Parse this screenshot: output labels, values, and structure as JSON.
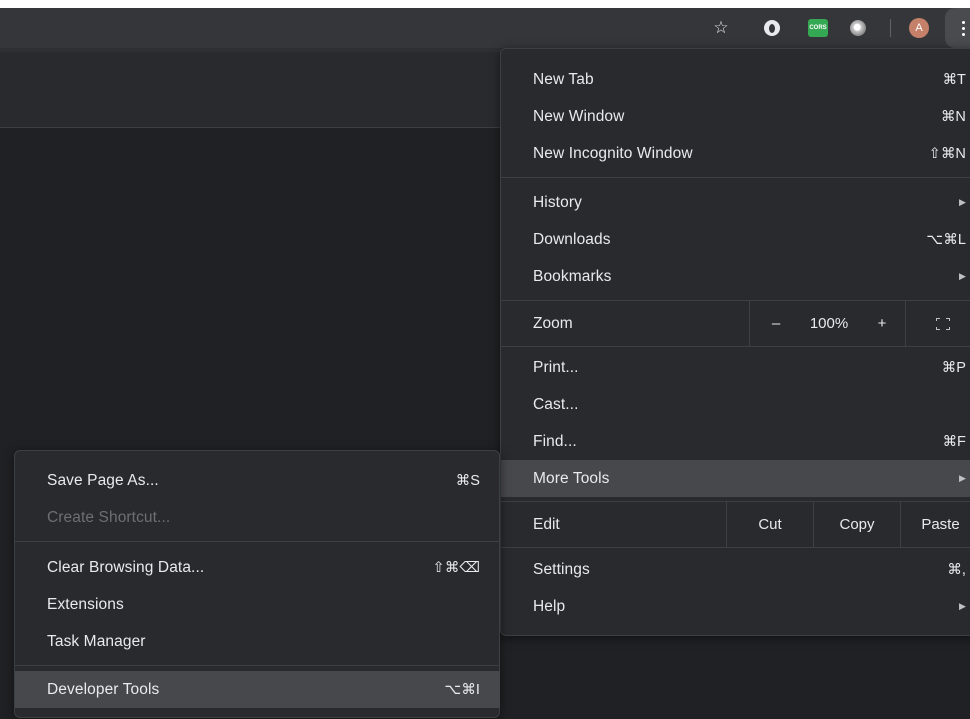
{
  "toolbar": {
    "star": "☆",
    "extension_cors": "CORS",
    "avatar_letter": "A"
  },
  "menu": {
    "new_tab": {
      "label": "New Tab",
      "shortcut": "⌘T"
    },
    "new_window": {
      "label": "New Window",
      "shortcut": "⌘N"
    },
    "new_incognito": {
      "label": "New Incognito Window",
      "shortcut": "⇧⌘N"
    },
    "history": {
      "label": "History",
      "arrow": "▶"
    },
    "downloads": {
      "label": "Downloads",
      "shortcut": "⌥⌘L"
    },
    "bookmarks": {
      "label": "Bookmarks",
      "arrow": "▶"
    },
    "zoom": {
      "label": "Zoom",
      "minus": "–",
      "level": "100%",
      "plus": "+"
    },
    "print": {
      "label": "Print...",
      "shortcut": "⌘P"
    },
    "cast": {
      "label": "Cast..."
    },
    "find": {
      "label": "Find...",
      "shortcut": "⌘F"
    },
    "more_tools": {
      "label": "More Tools",
      "arrow": "▶"
    },
    "edit": {
      "label": "Edit",
      "cut": "Cut",
      "copy": "Copy",
      "paste": "Paste"
    },
    "settings": {
      "label": "Settings",
      "shortcut": "⌘,"
    },
    "help": {
      "label": "Help",
      "arrow": "▶"
    }
  },
  "submenu": {
    "save_page_as": {
      "label": "Save Page As...",
      "shortcut": "⌘S"
    },
    "create_shortcut": {
      "label": "Create Shortcut..."
    },
    "clear_browsing_data": {
      "label": "Clear Browsing Data...",
      "shortcut": "⇧⌘⌫"
    },
    "extensions": {
      "label": "Extensions"
    },
    "task_manager": {
      "label": "Task Manager"
    },
    "developer_tools": {
      "label": "Developer Tools",
      "shortcut": "⌥⌘I"
    }
  },
  "colors": {
    "menu_bg": "#292a2d",
    "highlight": "#47484c",
    "text": "#e8eaed",
    "disabled_text": "#6c6f73"
  }
}
